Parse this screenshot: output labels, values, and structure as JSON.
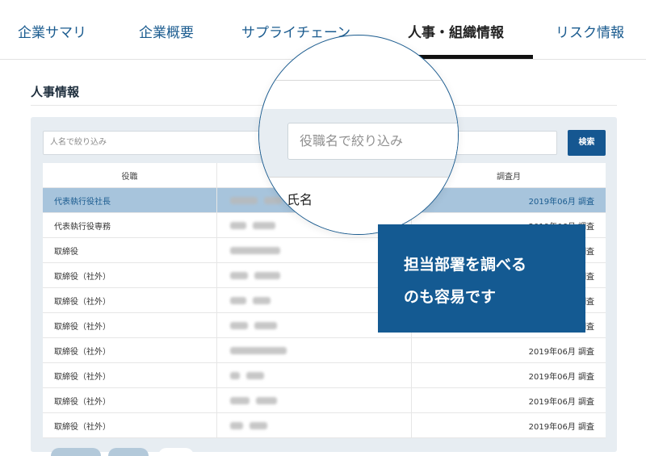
{
  "tabs": [
    {
      "label": "企業サマリ",
      "active": false
    },
    {
      "label": "企業概要",
      "active": false
    },
    {
      "label": "サプライチェーン",
      "active": false
    },
    {
      "label": "人事・組織情報",
      "active": true
    },
    {
      "label": "リスク情報",
      "active": false
    }
  ],
  "section": {
    "title": "人事情報"
  },
  "filters": {
    "name_placeholder": "人名で絞り込み",
    "title_placeholder": "役職名で絞り込み",
    "search_label": "検索"
  },
  "table": {
    "headers": [
      "役職",
      "氏名",
      "調査月"
    ],
    "rows": [
      {
        "title": "代表執行役社長",
        "date": "2019年06月 調査",
        "selected": true
      },
      {
        "title": "代表執行役専務",
        "date": "2019年06月 調査",
        "selected": false
      },
      {
        "title": "取締役",
        "date": "2019年06月 調査",
        "selected": false
      },
      {
        "title": "取締役（社外）",
        "date": "2019年06月 調査",
        "selected": false
      },
      {
        "title": "取締役（社外）",
        "date": "2019年06月 調査",
        "selected": false
      },
      {
        "title": "取締役（社外）",
        "date": "2019年06月 調査",
        "selected": false
      },
      {
        "title": "取締役（社外）",
        "date": "2019年06月 調査",
        "selected": false
      },
      {
        "title": "取締役（社外）",
        "date": "2019年06月 調査",
        "selected": false
      },
      {
        "title": "取締役（社外）",
        "date": "2019年06月 調査",
        "selected": false
      },
      {
        "title": "取締役（社外）",
        "date": "2019年06月 調査",
        "selected": false
      }
    ]
  },
  "magnifier": {
    "placeholder": "役職名で絞り込み",
    "column_label": "氏名"
  },
  "callout": {
    "line1": "担当部署を調べる",
    "line2": "のも容易です"
  },
  "colors": {
    "accent": "#155791",
    "tab_text": "#1a5b8f",
    "selected_row": "#a7c4dc",
    "panel_bg": "#e7edf2"
  }
}
